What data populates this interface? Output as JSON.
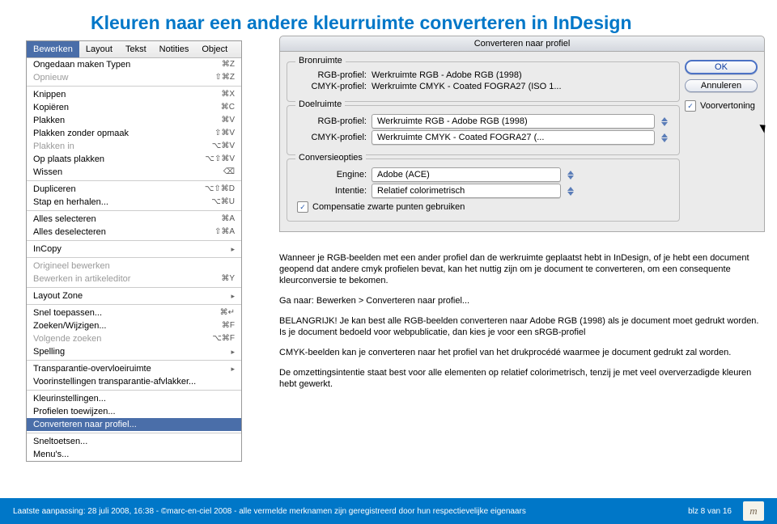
{
  "page": {
    "title": "Kleuren naar een andere kleurruimte converteren in InDesign"
  },
  "menu": {
    "tabs": [
      "Bewerken",
      "Layout",
      "Tekst",
      "Notities",
      "Object"
    ],
    "groups": [
      [
        {
          "label": "Ongedaan maken Typen",
          "shortcut": "⌘Z"
        },
        {
          "label": "Opnieuw",
          "shortcut": "⇧⌘Z",
          "dim": true
        }
      ],
      [
        {
          "label": "Knippen",
          "shortcut": "⌘X"
        },
        {
          "label": "Kopiëren",
          "shortcut": "⌘C"
        },
        {
          "label": "Plakken",
          "shortcut": "⌘V"
        },
        {
          "label": "Plakken zonder opmaak",
          "shortcut": "⇧⌘V"
        },
        {
          "label": "Plakken in",
          "shortcut": "⌥⌘V",
          "dim": true
        },
        {
          "label": "Op plaats plakken",
          "shortcut": "⌥⇧⌘V"
        },
        {
          "label": "Wissen",
          "shortcut": "⌫"
        }
      ],
      [
        {
          "label": "Dupliceren",
          "shortcut": "⌥⇧⌘D"
        },
        {
          "label": "Stap en herhalen...",
          "shortcut": "⌥⌘U"
        }
      ],
      [
        {
          "label": "Alles selecteren",
          "shortcut": "⌘A"
        },
        {
          "label": "Alles deselecteren",
          "shortcut": "⇧⌘A"
        }
      ],
      [
        {
          "label": "InCopy",
          "sub": true
        }
      ],
      [
        {
          "label": "Origineel bewerken",
          "dim": true
        },
        {
          "label": "Bewerken in artikeleditor",
          "shortcut": "⌘Y",
          "dim": true
        }
      ],
      [
        {
          "label": "Layout Zone",
          "sub": true
        }
      ],
      [
        {
          "label": "Snel toepassen...",
          "shortcut": "⌘↵"
        },
        {
          "label": "Zoeken/Wijzigen...",
          "shortcut": "⌘F"
        },
        {
          "label": "Volgende zoeken",
          "shortcut": "⌥⌘F",
          "dim": true
        },
        {
          "label": "Spelling",
          "sub": true
        }
      ],
      [
        {
          "label": "Transparantie-overvloeiruimte",
          "sub": true
        },
        {
          "label": "Voorinstellingen transparantie-afvlakker..."
        }
      ],
      [
        {
          "label": "Kleurinstellingen..."
        },
        {
          "label": "Profielen toewijzen..."
        },
        {
          "label": "Converteren naar profiel...",
          "highlight": true
        }
      ],
      [
        {
          "label": "Sneltoetsen..."
        },
        {
          "label": "Menu's..."
        }
      ]
    ]
  },
  "dialog": {
    "title": "Converteren naar profiel",
    "source": {
      "legend": "Bronruimte",
      "rgb_label": "RGB-profiel:",
      "rgb_value": "Werkruimte RGB - Adobe RGB (1998)",
      "cmyk_label": "CMYK-profiel:",
      "cmyk_value": "Werkruimte CMYK - Coated FOGRA27 (ISO 1..."
    },
    "dest": {
      "legend": "Doelruimte",
      "rgb_label": "RGB-profiel:",
      "rgb_value": "Werkruimte RGB - Adobe RGB (1998)",
      "cmyk_label": "CMYK-profiel:",
      "cmyk_value": "Werkruimte CMYK - Coated FOGRA27 (..."
    },
    "conv": {
      "legend": "Conversieopties",
      "engine_label": "Engine:",
      "engine_value": "Adobe (ACE)",
      "intent_label": "Intentie:",
      "intent_value": "Relatief colorimetrisch",
      "bpc": "Compensatie zwarte punten gebruiken"
    },
    "ok": "OK",
    "cancel": "Annuleren",
    "preview": "Voorvertoning"
  },
  "body": {
    "p1": "Wanneer je RGB-beelden met een ander profiel dan de werkruimte geplaatst hebt in InDesign, of je hebt een document geopend dat andere cmyk profielen bevat, kan het nuttig zijn om je document te converteren, om een consequente kleurconversie te bekomen.",
    "p2": "Ga naar: Bewerken > Converteren naar profiel...",
    "p3": "BELANGRIJK! Je kan best alle RGB-beelden converteren naar Adobe RGB (1998) als je document moet gedrukt worden. Is je document bedoeld voor webpublicatie, dan kies je voor een sRGB-profiel",
    "p4": "CMYK-beelden kan je converteren naar het profiel van het drukprocédé waarmee je document gedrukt zal worden.",
    "p5": "De omzettingsintentie staat best voor alle elementen op relatief colorimetrisch, tenzij je met veel oververzadigde kleuren hebt gewerkt."
  },
  "footer": {
    "left": "Laatste aanpassing: 28 juli 2008, 16:38 - ©marc-en-ciel 2008 - alle vermelde merknamen zijn geregistreerd door hun respectievelijke eigenaars",
    "right": "blz 8 van 16",
    "logo": "m"
  }
}
